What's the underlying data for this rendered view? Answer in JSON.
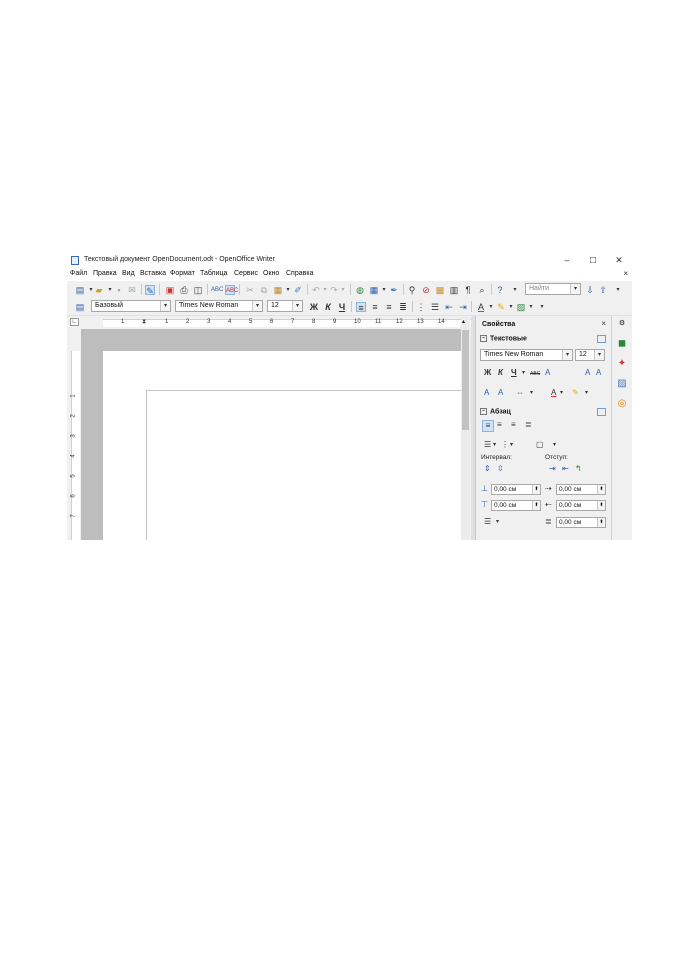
{
  "window": {
    "title": "Текстовый документ OpenDocument.odt - OpenOffice Writer",
    "minimize": "–",
    "maximize": "☐",
    "close": "✕"
  },
  "menu": {
    "items": [
      "Файл",
      "Правка",
      "Вид",
      "Вставка",
      "Формат",
      "Таблица",
      "Сервис",
      "Окно",
      "Справка"
    ],
    "doc_close": "×"
  },
  "toolbar_standard": {
    "search_placeholder": "Найти"
  },
  "toolbar_format": {
    "style": "Базовый",
    "font": "Times New Roman",
    "size": "12",
    "bold": "Ж",
    "italic": "К",
    "underline": "Ч"
  },
  "ruler": {
    "numbers": [
      "1",
      "1",
      "2",
      "3",
      "4",
      "5",
      "6",
      "7",
      "8",
      "9",
      "10",
      "11",
      "12",
      "13",
      "14"
    ],
    "vertical_numbers": [
      "1",
      "2",
      "3",
      "4",
      "5",
      "6",
      "7"
    ]
  },
  "sidebar": {
    "title": "Свойства",
    "close": "×",
    "text_section": {
      "title": "Текстовые",
      "font": "Times New Roman",
      "size": "12",
      "bold": "Ж",
      "italic": "К",
      "underline": "Ч",
      "strike": "ABC"
    },
    "paragraph_section": {
      "title": "Абзац",
      "spacing_label": "Интервал:",
      "indent_label": "Отступ:",
      "above_spacing": "0,00 см",
      "below_spacing": "0,00 см",
      "before_indent": "0,00 см",
      "after_indent": "0,00 см",
      "first_line_indent": "0,00 см"
    }
  },
  "colors": {
    "page_bg": "#bdbdbd",
    "active_button": "#cde2f6",
    "chrome": "#f0f0f0"
  }
}
